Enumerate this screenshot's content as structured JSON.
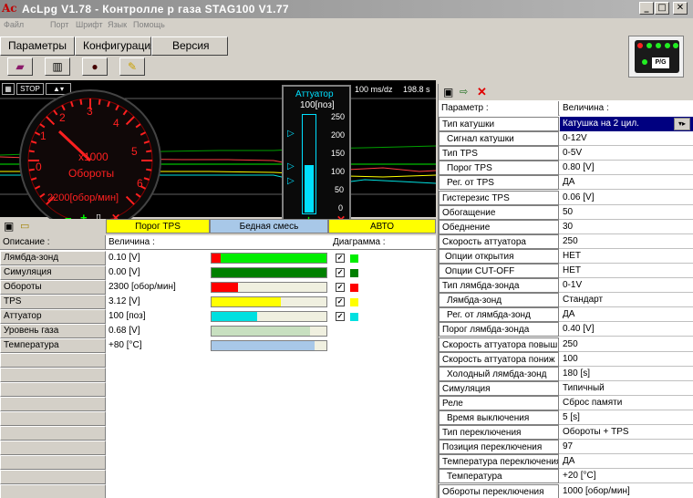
{
  "window": {
    "title": "AcLpg V1.78 -  Контролле р  газа  STAG100 V1.77",
    "logo": "Ac"
  },
  "menu": [
    "Файл",
    "Порт",
    "Шрифт",
    "Язык",
    "Помощь"
  ],
  "tabs": [
    "Параметры",
    "Конфигурация",
    "Версия"
  ],
  "gas_indicator": {
    "label": "P/G"
  },
  "scope": {
    "stop_label": "STOP",
    "timebase": "100 ms/dz",
    "value": "198.8 s"
  },
  "tachometer": {
    "unit_label": "x1000",
    "title": "Обороты",
    "readout": "2200[обор/мин]",
    "ticks": [
      "0",
      "1",
      "2",
      "3",
      "4",
      "5",
      "6"
    ],
    "rpm_value": 2200
  },
  "actuator": {
    "title": "Аттуатор",
    "readout": "100[поз]",
    "ticks": [
      "250",
      "200",
      "150",
      "100",
      "50",
      "0"
    ],
    "position": 100
  },
  "status_bar": {
    "tps": "Порог TPS",
    "mixture": "Бедная смесь",
    "mode": "АВТО"
  },
  "left_table": {
    "headers": {
      "desc": "Описание :",
      "value": "Величина :",
      "diagram": "Диаграмма :"
    },
    "rows": [
      {
        "name": "Лямбда-зонд",
        "value": "0.10 [V]",
        "color": "#00ee00",
        "mark": "#ff0000",
        "fill": 0.08,
        "checked": true,
        "swatch": "#00ee00"
      },
      {
        "name": "Симуляция",
        "value": "0.00 [V]",
        "color": "#008000",
        "mark": "",
        "fill": 1.0,
        "checked": true,
        "swatch": "#008000"
      },
      {
        "name": "Обороты",
        "value": "2300 [обор/мин]",
        "color": "#ff0000",
        "mark": "",
        "fill": 0.23,
        "checked": true,
        "swatch": "#ff0000"
      },
      {
        "name": "TPS",
        "value": "3.12 [V]",
        "color": "#ffff00",
        "mark": "",
        "fill": 0.6,
        "checked": true,
        "swatch": "#ffff00"
      },
      {
        "name": "Аттуатор",
        "value": "100 [поз]",
        "color": "#00e0e0",
        "mark": "",
        "fill": 0.4,
        "checked": true,
        "swatch": "#00e0e0"
      },
      {
        "name": "Уровень газа",
        "value": "0.68 [V]",
        "color": "#c8e0c0",
        "mark": "",
        "fill": 0.86,
        "checked": false,
        "swatch": ""
      },
      {
        "name": "Температура",
        "value": "+80 [°C]",
        "color": "#a8c8e8",
        "mark": "",
        "fill": 0.9,
        "checked": false,
        "swatch": ""
      }
    ]
  },
  "right_table": {
    "headers": {
      "param": "Параметр :",
      "value": "Величина :"
    },
    "rows": [
      {
        "p": "Тип катушки",
        "v": "Катушка на 2 цил.",
        "indent": "",
        "sel": true
      },
      {
        "p": "Сигнал катушки",
        "v": "0-12V",
        "indent": "ind"
      },
      {
        "p": "Тип TPS",
        "v": "0-5V",
        "indent": ""
      },
      {
        "p": "Порог TPS",
        "v": "0.80 [V]",
        "indent": "ind"
      },
      {
        "p": "Рег. от TPS",
        "v": "ДА",
        "indent": "ind"
      },
      {
        "p": "Гистерезис TPS",
        "v": "0.06 [V]",
        "indent": ""
      },
      {
        "p": "Обогащение",
        "v": "50",
        "indent": ""
      },
      {
        "p": "Обеднение",
        "v": "30",
        "indent": ""
      },
      {
        "p": "Скорость аттуатора",
        "v": "250",
        "indent": ""
      },
      {
        "p": "Опции открытия",
        "v": "НЕТ",
        "indent": "sub"
      },
      {
        "p": "Опции CUT-OFF",
        "v": "НЕТ",
        "indent": "sub"
      },
      {
        "p": "Тип лямбда-зонда",
        "v": "0-1V",
        "indent": ""
      },
      {
        "p": "Лямбда-зонд",
        "v": "Стандарт",
        "indent": "ind"
      },
      {
        "p": "Рег. от лямбда-зонд",
        "v": "ДА",
        "indent": "ind"
      },
      {
        "p": "Порог лямбда-зонда",
        "v": "0.40 [V]",
        "indent": ""
      },
      {
        "p": "Скорость аттуатора повыш",
        "v": "250",
        "indent": ""
      },
      {
        "p": "Скорость аттуатора пониж",
        "v": "100",
        "indent": ""
      },
      {
        "p": "Холодный лямбда-зонд",
        "v": "180 [s]",
        "indent": "ind"
      },
      {
        "p": "Симуляция",
        "v": "Типичный",
        "indent": ""
      },
      {
        "p": "Реле",
        "v": "Сброс памяти",
        "indent": ""
      },
      {
        "p": "Время выключения",
        "v": "5 [s]",
        "indent": "ind"
      },
      {
        "p": "Тип переключения",
        "v": "Обороты + TPS",
        "indent": ""
      },
      {
        "p": "Позиция переключения",
        "v": "97",
        "indent": ""
      },
      {
        "p": "Температура переключения",
        "v": "ДА",
        "indent": ""
      },
      {
        "p": "Температура",
        "v": "+20 [°C]",
        "indent": "ind"
      },
      {
        "p": "Обороты переключения",
        "v": "1000 [обор/мин]",
        "indent": ""
      }
    ]
  }
}
